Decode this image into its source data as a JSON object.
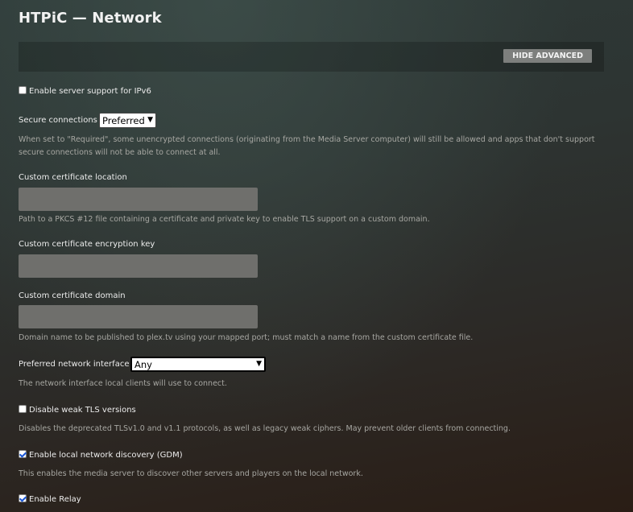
{
  "header": {
    "title": "HTPiC — Network"
  },
  "toolbar": {
    "hide_advanced_label": "HIDE ADVANCED"
  },
  "settings": {
    "ipv6": {
      "label": "Enable server support for IPv6",
      "checked": false
    },
    "secure_connections": {
      "label": "Secure connections",
      "value": "Preferred",
      "help": "When set to \"Required\", some unencrypted connections (originating from the Media Server computer) will still be allowed and apps that don't support secure connections will not be able to connect at all."
    },
    "cert_location": {
      "label": "Custom certificate location",
      "value": "",
      "help": "Path to a PKCS #12 file containing a certificate and private key to enable TLS support on a custom domain."
    },
    "cert_key": {
      "label": "Custom certificate encryption key",
      "value": ""
    },
    "cert_domain": {
      "label": "Custom certificate domain",
      "value": "",
      "help": "Domain name to be published to plex.tv using your mapped port; must match a name from the custom certificate file."
    },
    "network_interface": {
      "label": "Preferred network interface",
      "value": "Any",
      "help": "The network interface local clients will use to connect."
    },
    "weak_tls": {
      "label": "Disable weak TLS versions",
      "checked": false,
      "help": "Disables the deprecated TLSv1.0 and v1.1 protocols, as well as legacy weak ciphers. May prevent older clients from connecting."
    },
    "gdm": {
      "label": "Enable local network discovery (GDM)",
      "checked": true,
      "help": "This enables the media server to discover other servers and players on the local network."
    },
    "relay": {
      "label": "Enable Relay",
      "checked": true
    }
  }
}
